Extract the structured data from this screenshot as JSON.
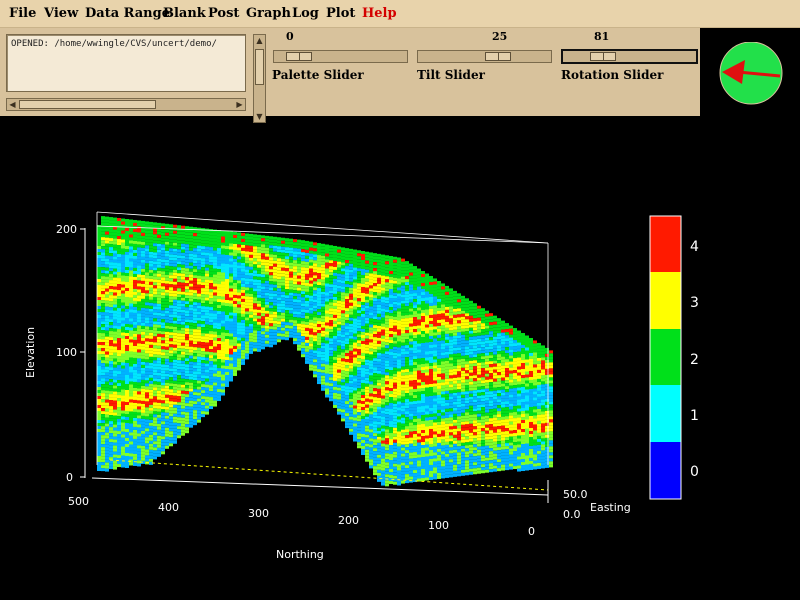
{
  "menu": {
    "items": [
      {
        "label": "File",
        "color": "#000000"
      },
      {
        "label": "View",
        "color": "#000000"
      },
      {
        "label": "Data Range",
        "color": "#000000"
      },
      {
        "label": "Blank",
        "color": "#000000"
      },
      {
        "label": "Post",
        "color": "#000000"
      },
      {
        "label": "Graph",
        "color": "#000000"
      },
      {
        "label": "Log",
        "color": "#000000"
      },
      {
        "label": "Plot",
        "color": "#000000"
      },
      {
        "label": "Help",
        "color": "#d40000"
      }
    ]
  },
  "log": {
    "text": "OPENED: /home/wwingle/CVS/uncert/demo/"
  },
  "sliders": {
    "palette": {
      "label": "Palette Slider",
      "value": "0"
    },
    "tilt": {
      "label": "Tilt Slider",
      "value": "25"
    },
    "rotation": {
      "label": "Rotation Slider",
      "value": "81"
    }
  },
  "compass": {
    "icon": "direction-arrow-icon",
    "fill": "#22e04a",
    "arrow_color": "#e01010"
  },
  "plot": {
    "elevation_axis": {
      "label": "Elevation",
      "ticks": [
        "0",
        "100",
        "200"
      ]
    },
    "northing_axis": {
      "label": "Northing",
      "ticks": [
        "500",
        "400",
        "300",
        "200",
        "100",
        "0"
      ]
    },
    "easting_axis": {
      "label": "Easting",
      "ticks": [
        "0.0",
        "50.0"
      ]
    },
    "legend": {
      "entries": [
        {
          "label": "4",
          "color": "#ff1a00"
        },
        {
          "label": "3",
          "color": "#ffff00"
        },
        {
          "label": "2",
          "color": "#00e01a"
        },
        {
          "label": "1",
          "color": "#00ffff"
        },
        {
          "label": "0",
          "color": "#0000ff"
        }
      ]
    },
    "palette": {
      "0": "#0000ff",
      "1": "#00b2ff",
      "1b": "#00e6ff",
      "2": "#00e01a",
      "2b": "#7dff2a",
      "3": "#ffff00",
      "4": "#ff1a00"
    }
  }
}
